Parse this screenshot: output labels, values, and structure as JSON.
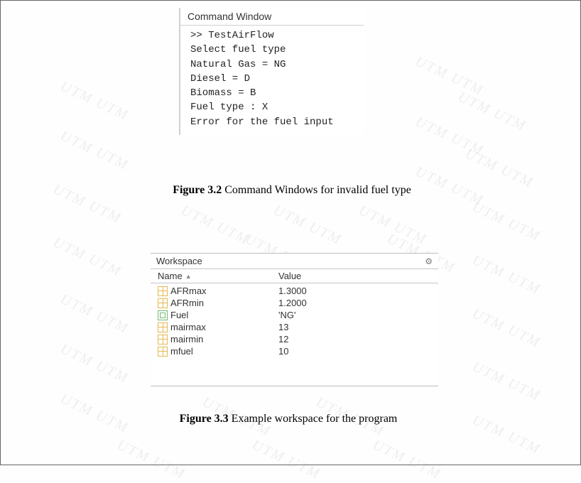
{
  "command_window": {
    "title": "Command Window",
    "lines": {
      "l1": ">> TestAirFlow",
      "l2": "Select fuel type",
      "l3": "Natural Gas = NG",
      "l4": "Diesel = D",
      "l5": "Biomass = B",
      "l6": "Fuel type : X",
      "l7": "",
      "l8": "Error for the fuel input"
    }
  },
  "captions": {
    "fig1_bold": "Figure 3.2",
    "fig1_rest": " Command Windows for invalid fuel type",
    "fig2_bold": "Figure 3.3",
    "fig2_rest": " Example workspace for the program"
  },
  "workspace": {
    "title": "Workspace",
    "columns": {
      "name": "Name",
      "value": "Value"
    },
    "rows": [
      {
        "name": "AFRmax",
        "value": "1.3000",
        "type": "num"
      },
      {
        "name": "AFRmin",
        "value": "1.2000",
        "type": "num"
      },
      {
        "name": "Fuel",
        "value": "'NG'",
        "type": "str"
      },
      {
        "name": "mairmax",
        "value": "13",
        "type": "num"
      },
      {
        "name": "mairmin",
        "value": "12",
        "type": "num"
      },
      {
        "name": "mfuel",
        "value": "10",
        "type": "num"
      }
    ]
  },
  "chart_data": {
    "type": "table",
    "title": "Workspace",
    "columns": [
      "Name",
      "Value"
    ],
    "rows": [
      [
        "AFRmax",
        1.3
      ],
      [
        "AFRmin",
        1.2
      ],
      [
        "Fuel",
        "NG"
      ],
      [
        "mairmax",
        13
      ],
      [
        "mairmin",
        12
      ],
      [
        "mfuel",
        10
      ]
    ]
  },
  "watermark_text": "UTM UTM"
}
